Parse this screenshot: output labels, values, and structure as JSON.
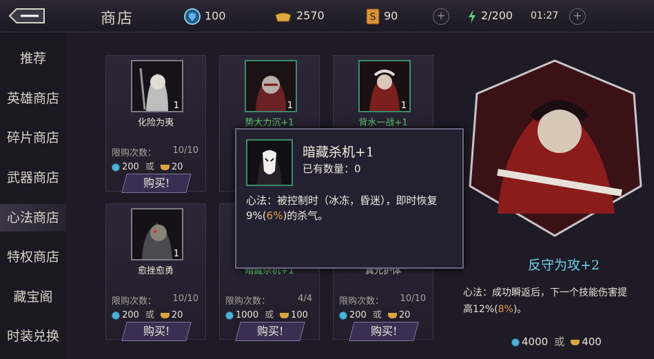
{
  "header": {
    "title": "商店",
    "resources": {
      "shield": "100",
      "gold": "2570",
      "token": "90",
      "energy": "2/200",
      "timer": "01:27"
    },
    "plus": "+"
  },
  "sidebar": {
    "items": [
      {
        "label": "推荐"
      },
      {
        "label": "英雄商店"
      },
      {
        "label": "碎片商店"
      },
      {
        "label": "武器商店"
      },
      {
        "label": "心法商店"
      },
      {
        "label": "特权商店"
      },
      {
        "label": "藏宝阁"
      },
      {
        "label": "时装兑换"
      }
    ],
    "active_index": 4
  },
  "cards": [
    {
      "name": "化险为夷",
      "count": "1",
      "limit_label": "限购次数：",
      "limit": "10/10",
      "gem": "200",
      "or": "或",
      "gold": "20",
      "buy": "购买!"
    },
    {
      "name": "势大力沉+1",
      "count": "1"
    },
    {
      "name": "背水一战+1",
      "count": "1"
    },
    {
      "name": "愈挫愈勇",
      "count": "1",
      "limit_label": "限购次数：",
      "limit": "10/10",
      "gem": "200",
      "or": "或",
      "gold": "20",
      "buy": "购买!"
    },
    {
      "name": "暗藏杀机+1",
      "limit_label": "限购次数：",
      "limit": "4/4",
      "gem": "1000",
      "or": "或",
      "gold": "100",
      "buy": "购买!"
    },
    {
      "name": "真元护体",
      "limit_label": "限购次数：",
      "limit": "10/10",
      "gem": "200",
      "or": "或",
      "gold": "20",
      "buy": "购买!"
    }
  ],
  "popup": {
    "title": "暗藏杀机+1",
    "owned": "已有数量：0",
    "desc_a": "心法：被控制时（冰冻，昏迷），即时恢复9%(",
    "desc_pct": "6%",
    "desc_b": ")的杀气。"
  },
  "feature": {
    "name": "反守为攻+2",
    "desc_a": "心法：成功瞬返后，下一个技能伤害提",
    "desc_b": "高12%(",
    "desc_pct": "8%",
    "desc_c": ")。",
    "gem": "4000",
    "or": "或",
    "gold": "400"
  },
  "colors": {
    "accent_cyan": "#6fd0e8",
    "green_name": "#5ecb6e",
    "highlight_orange": "#e0a040"
  }
}
